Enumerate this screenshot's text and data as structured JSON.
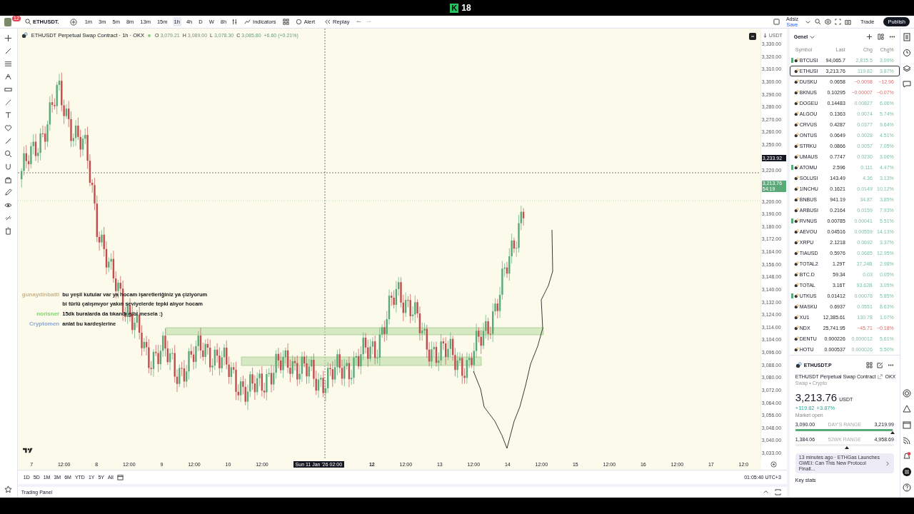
{
  "brand": {
    "logo": "K",
    "number": "18"
  },
  "toolbar": {
    "notifications": "12",
    "symbol": "ETHUSDT.",
    "intervals": [
      {
        "label": "1m",
        "selected": false
      },
      {
        "label": "3m",
        "selected": false
      },
      {
        "label": "5m",
        "selected": false
      },
      {
        "label": "8m",
        "selected": false
      },
      {
        "label": "13m",
        "selected": false
      },
      {
        "label": "15m",
        "selected": false
      },
      {
        "label": "1h",
        "selected": true
      },
      {
        "label": "4h",
        "selected": false
      },
      {
        "label": "D",
        "selected": false
      },
      {
        "label": "W",
        "selected": false
      },
      {
        "label": "8h",
        "selected": false
      }
    ],
    "indicators": "Indicators",
    "alert": "Alert",
    "replay": "Replay",
    "layout_name": "Adsiz",
    "layout_status": "Save",
    "trade": "Trade",
    "publish": "Publish"
  },
  "legend": {
    "title": "ETHUSDT Perpetual Swap Contract · 1h · OKX",
    "ohlc": [
      {
        "label": "O",
        "value": "3,079.21"
      },
      {
        "label": "H",
        "value": "3,089.00"
      },
      {
        "label": "L",
        "value": "3,078.30"
      },
      {
        "label": "C",
        "value": "3,085.80"
      }
    ],
    "change": "+6.60 (+0.21%)"
  },
  "price_axis": {
    "currency": "USDT",
    "ticks": [
      "3,330.00",
      "3,320.00",
      "3,310.00",
      "3,300.00",
      "3,290.00",
      "3,280.00",
      "3,270.00",
      "3,260.00",
      "3,250.00",
      "3,220.00",
      "3,200.00",
      "3,190.00",
      "3,180.00",
      "3,172.00",
      "3,164.00",
      "3,156.00",
      "3,148.00",
      "3,140.00",
      "3,132.00",
      "3,124.00",
      "3,114.00",
      "3,104.00",
      "3,096.00",
      "3,088.00",
      "3,080.00",
      "3,072.00",
      "3,064.00",
      "3,056.00",
      "3,048.00",
      "3,040.00",
      "3,033.00"
    ],
    "crosshair_label": "3,233.92",
    "last_price": "3,213.76",
    "countdown": "54:19"
  },
  "time_axis": [
    {
      "label": "7",
      "kind": "day"
    },
    {
      "label": "12:00",
      "kind": "time"
    },
    {
      "label": "8",
      "kind": "day"
    },
    {
      "label": "12:00",
      "kind": "time"
    },
    {
      "label": "9",
      "kind": "day"
    },
    {
      "label": "12:00",
      "kind": "time"
    },
    {
      "label": "10",
      "kind": "day"
    },
    {
      "label": "12:00",
      "kind": "time"
    },
    {
      "label": "Sun 11 Jan '26  02:00",
      "kind": "crosshair"
    },
    {
      "label": "12",
      "kind": "major"
    },
    {
      "label": "12:00",
      "kind": "time"
    },
    {
      "label": "13",
      "kind": "day"
    },
    {
      "label": "12:00",
      "kind": "time"
    },
    {
      "label": "14",
      "kind": "day"
    },
    {
      "label": "12:00",
      "kind": "time"
    },
    {
      "label": "15",
      "kind": "day"
    },
    {
      "label": "12:00",
      "kind": "time"
    },
    {
      "label": "16",
      "kind": "day"
    },
    {
      "label": "12:00",
      "kind": "time"
    },
    {
      "label": "17",
      "kind": "day"
    },
    {
      "label": "12:0",
      "kind": "time"
    }
  ],
  "chat": [
    {
      "user": "gunaydinbatti",
      "color": "#c9b48c",
      "message": "bu yeşil kutular var ya hocam işaretleriğiniz ya çiziyorum bi türlü çalışmıyor yakın seviyelerde tepki alıyor hocam"
    },
    {
      "user": "norisner",
      "color": "#7fd46a",
      "message": "15dk buralarda da tıkandı gibi mesela :)"
    },
    {
      "user": "Cryptomen",
      "color": "#8aa6d8",
      "message": "anlat bu kardeşlerine"
    }
  ],
  "ranges": [
    "1D",
    "5D",
    "1M",
    "3M",
    "6M",
    "YTD",
    "1Y",
    "5Y",
    "All"
  ],
  "clock": "01:05:40 UTC+3",
  "trading_panel": "Trading Panel",
  "watchlist": {
    "title": "Genel",
    "columns": [
      "Symbol",
      "Last",
      "Chg",
      "Chg%"
    ],
    "rows": [
      {
        "symbol": "BTCUSI",
        "last": "94,065.7",
        "chg": "2,815.5",
        "chg_pct": "3.09%",
        "negative": false,
        "flagged": true,
        "selected": false
      },
      {
        "symbol": "ETHUSI",
        "last": "3,213.76",
        "chg": "119.82",
        "chg_pct": "3.87%",
        "negative": false,
        "flagged": false,
        "selected": true
      },
      {
        "symbol": "DUSKU",
        "last": "0.0658",
        "chg": "−0.0098",
        "chg_pct": "−12.96",
        "negative": true,
        "flagged": false,
        "selected": false
      },
      {
        "symbol": "BKNUS",
        "last": "0.10295",
        "chg": "−0.00007",
        "chg_pct": "−0.07%",
        "negative": true,
        "flagged": false,
        "selected": false
      },
      {
        "symbol": "DOGEU",
        "last": "0.14483",
        "chg": "0.00827",
        "chg_pct": "6.06%",
        "negative": false,
        "flagged": false,
        "selected": false
      },
      {
        "symbol": "ALGOU",
        "last": "0.1363",
        "chg": "0.0074",
        "chg_pct": "5.74%",
        "negative": false,
        "flagged": false,
        "selected": false
      },
      {
        "symbol": "CRVUS",
        "last": "0.4287",
        "chg": "0.0377",
        "chg_pct": "9.64%",
        "negative": false,
        "flagged": false,
        "selected": false
      },
      {
        "symbol": "ONTUS",
        "last": "0.0649",
        "chg": "0.0028",
        "chg_pct": "4.51%",
        "negative": false,
        "flagged": false,
        "selected": false
      },
      {
        "symbol": "STRKU",
        "last": "0.0866",
        "chg": "0.0057",
        "chg_pct": "7.05%",
        "negative": false,
        "flagged": false,
        "selected": false
      },
      {
        "symbol": "UMAUS",
        "last": "0.7747",
        "chg": "0.0230",
        "chg_pct": "3.06%",
        "negative": false,
        "flagged": false,
        "selected": false
      },
      {
        "symbol": "ATOMU",
        "last": "2.596",
        "chg": "0.111",
        "chg_pct": "4.47%",
        "negative": false,
        "flagged": true,
        "selected": false
      },
      {
        "symbol": "SOLUSI",
        "last": "143.49",
        "chg": "4.36",
        "chg_pct": "3.13%",
        "negative": false,
        "flagged": false,
        "selected": false
      },
      {
        "symbol": "1INCHU",
        "last": "0.1621",
        "chg": "0.0149",
        "chg_pct": "10.12%",
        "negative": false,
        "flagged": false,
        "selected": false
      },
      {
        "symbol": "BNBUS",
        "last": "941.19",
        "chg": "34.87",
        "chg_pct": "3.85%",
        "negative": false,
        "flagged": false,
        "selected": false
      },
      {
        "symbol": "ARBUSI",
        "last": "0.2164",
        "chg": "0.0159",
        "chg_pct": "7.93%",
        "negative": false,
        "flagged": false,
        "selected": false
      },
      {
        "symbol": "RVNUS",
        "last": "0.00785",
        "chg": "0.00041",
        "chg_pct": "5.51%",
        "negative": false,
        "flagged": true,
        "selected": false
      },
      {
        "symbol": "AEVOU",
        "last": "0.04516",
        "chg": "0.00559",
        "chg_pct": "14.13%",
        "negative": false,
        "flagged": false,
        "selected": false
      },
      {
        "symbol": "XRPU",
        "last": "2.1218",
        "chg": "0.0692",
        "chg_pct": "3.37%",
        "negative": false,
        "flagged": false,
        "selected": false
      },
      {
        "symbol": "TIAUSD",
        "last": "0.5976",
        "chg": "0.0685",
        "chg_pct": "12.95%",
        "negative": false,
        "flagged": false,
        "selected": false
      },
      {
        "symbol": "TOTAL2",
        "last": "1.29T",
        "chg": "37.24B",
        "chg_pct": "2.98%",
        "negative": false,
        "flagged": false,
        "selected": false
      },
      {
        "symbol": "BTC.D",
        "last": "59.34",
        "chg": "0.03",
        "chg_pct": "0.05%",
        "negative": false,
        "flagged": false,
        "selected": false
      },
      {
        "symbol": "TOTAL",
        "last": "3.16T",
        "chg": "93.62B",
        "chg_pct": "3.05%",
        "negative": false,
        "flagged": false,
        "selected": false
      },
      {
        "symbol": "UTKUS",
        "last": "0.01412",
        "chg": "0.00078",
        "chg_pct": "5.85%",
        "negative": false,
        "flagged": true,
        "selected": false
      },
      {
        "symbol": "MASKU",
        "last": "0.6937",
        "chg": "0.0551",
        "chg_pct": "8.63%",
        "negative": false,
        "flagged": false,
        "selected": false
      },
      {
        "symbol": "XU1",
        "last": "12,385.61",
        "chg": "130.78",
        "chg_pct": "1.07%",
        "negative": false,
        "flagged": false,
        "selected": false
      },
      {
        "symbol": "NDX",
        "last": "25,741.95",
        "chg": "−45.71",
        "chg_pct": "−0.18%",
        "negative": true,
        "flagged": false,
        "selected": false
      },
      {
        "symbol": "DENTU",
        "last": "0.000226",
        "chg": "0.000012",
        "chg_pct": "5.61%",
        "negative": false,
        "flagged": false,
        "selected": false
      },
      {
        "symbol": "HOTU",
        "last": "0.000537",
        "chg": "0.000026",
        "chg_pct": "5.50%",
        "negative": false,
        "flagged": false,
        "selected": false
      }
    ]
  },
  "details": {
    "symbol": "ETHUSDT.P",
    "name": "ETHUSDT Perpetual Swap Contract",
    "exchange": "OKX",
    "category": "Swap • Crypto",
    "price": "3,213.76",
    "currency": "USDT",
    "change": "+119.82",
    "change_pct": "+3.87%",
    "status": "Market open",
    "ranges": [
      {
        "low": "3,090.00",
        "label": "DAY'S RANGE",
        "high": "3,219.99",
        "level": 0.99
      },
      {
        "low": "1,384.06",
        "label": "52WK RANGE",
        "high": "4,958.69",
        "level": 0.52
      }
    ],
    "news": "13 minutes ago · ETHGas Launches GWEI: Can This New Protocol Finall...",
    "key_stats": "Key stats"
  }
}
